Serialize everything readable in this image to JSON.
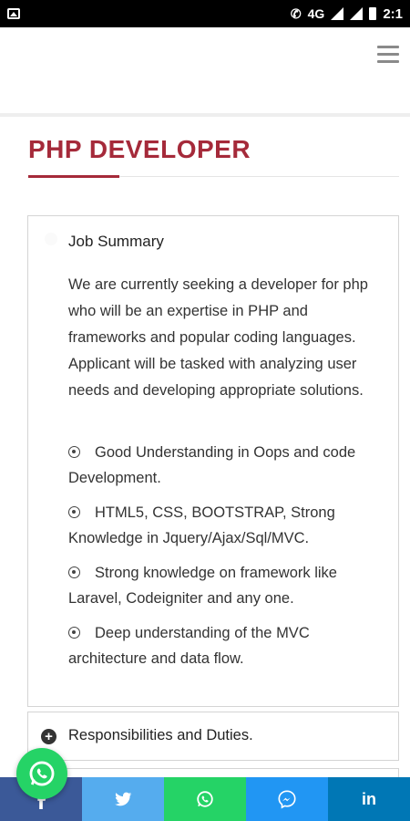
{
  "status_bar": {
    "network_label": "4G",
    "time": "2:1"
  },
  "page": {
    "title": "PHP DEVELOPER"
  },
  "job_summary": {
    "heading": "Job Summary",
    "text": "We are currently seeking a developer for php who will be an expertise in PHP and frameworks and popular coding languages. Applicant will be tasked with analyzing user needs and developing appropriate solutions.",
    "bullets": [
      "Good Understanding in Oops and code Development.",
      "HTML5, CSS, BOOTSTRAP, Strong Knowledge in Jquery/Ajax/Sql/MVC.",
      "Strong knowledge on framework like Laravel, Codeigniter and any one.",
      "Deep understanding of the MVC architecture and data flow."
    ]
  },
  "accordion": {
    "responsibilities_label": "Responsibilities and Duties."
  },
  "share_bar": {
    "linkedin_label": "in",
    "colors": {
      "facebook": "#3b5998",
      "twitter": "#55acee",
      "whatsapp": "#25d366",
      "messenger": "#2196f3",
      "linkedin": "#0077b5"
    },
    "icons": [
      "facebook-icon",
      "twitter-icon",
      "whatsapp-icon",
      "messenger-icon",
      "linkedin-icon"
    ]
  },
  "theme": {
    "accent": "#a52a3a"
  }
}
